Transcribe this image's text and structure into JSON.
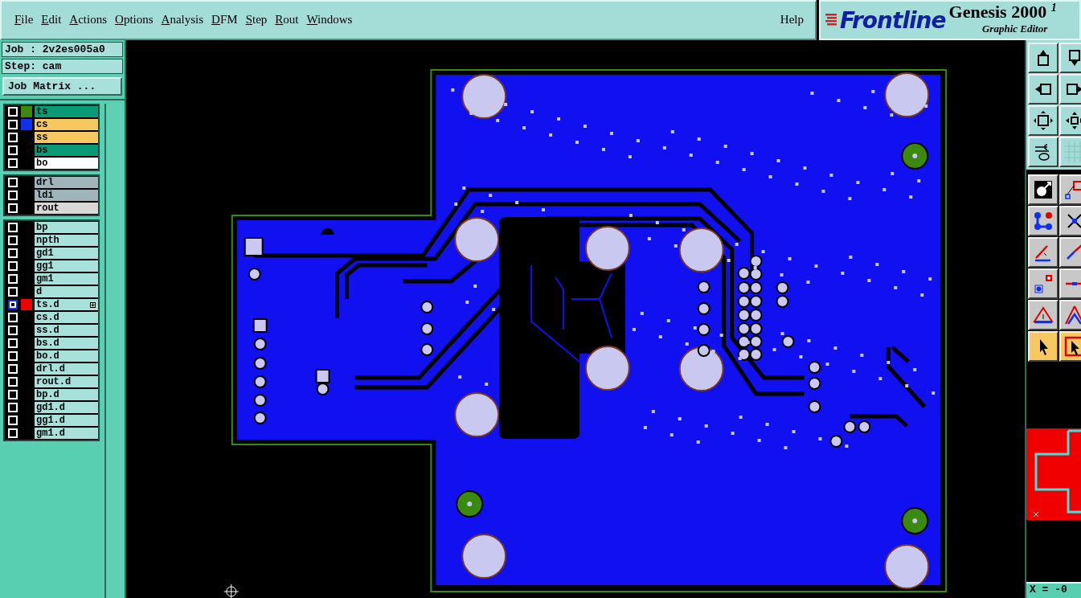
{
  "menu": [
    {
      "label": "File"
    },
    {
      "label": "Edit"
    },
    {
      "label": "Actions"
    },
    {
      "label": "Options"
    },
    {
      "label": "Analysis"
    },
    {
      "label": "DFM"
    },
    {
      "label": "Step"
    },
    {
      "label": "Rout"
    },
    {
      "label": "Windows"
    }
  ],
  "help": "Help",
  "logo": {
    "brand": "Frontline",
    "product": "Genesis 2000",
    "version_mark": "1",
    "subtitle": "Graphic Editor"
  },
  "job": "Job : 2v2es005a0",
  "step": "Step: cam",
  "matrix_button": "Job Matrix ...",
  "layer_groups": [
    [
      {
        "name": "ts",
        "color": "#0a9a78",
        "swatch": {
          "color": "#3a8a10"
        },
        "selected": false
      },
      {
        "name": "cs",
        "color": "#f8c860",
        "swatch": {
          "color": "#1030f0"
        },
        "selected": false
      },
      {
        "name": "ss",
        "color": "#f8c860",
        "selected": false
      },
      {
        "name": "bs",
        "color": "#0a9a78",
        "selected": false
      },
      {
        "name": "bo",
        "color": "#ffffff",
        "selected": false
      }
    ],
    [
      {
        "name": "drl",
        "color": "#a0b4bc",
        "selected": false
      },
      {
        "name": "ldi",
        "color": "#a0b4bc",
        "selected": false
      },
      {
        "name": "rout",
        "color": "#d8d8d8",
        "selected": false
      }
    ],
    [
      {
        "name": "bp",
        "color": "#a8e0dc",
        "selected": false
      },
      {
        "name": "npth",
        "color": "#a8e0dc",
        "selected": false
      },
      {
        "name": "gd1",
        "color": "#a8e0dc",
        "selected": false
      },
      {
        "name": "gg1",
        "color": "#a8e0dc",
        "selected": false
      },
      {
        "name": "gm1",
        "color": "#a8e0dc",
        "selected": false
      },
      {
        "name": "d",
        "color": "#a8e0dc",
        "selected": false
      },
      {
        "name": "ts.d",
        "color": "#a8e0dc",
        "swatch": {
          "color": "#f00000"
        },
        "selected": true
      },
      {
        "name": "cs.d",
        "color": "#a8e0dc",
        "selected": false
      },
      {
        "name": "ss.d",
        "color": "#a8e0dc",
        "selected": false
      },
      {
        "name": "bs.d",
        "color": "#a8e0dc",
        "selected": false
      },
      {
        "name": "bo.d",
        "color": "#a8e0dc",
        "selected": false
      },
      {
        "name": "drl.d",
        "color": "#a8e0dc",
        "selected": false
      },
      {
        "name": "rout.d",
        "color": "#a8e0dc",
        "selected": false
      },
      {
        "name": "bp.d",
        "color": "#a8e0dc",
        "selected": false
      },
      {
        "name": "gd1.d",
        "color": "#a8e0dc",
        "selected": false
      },
      {
        "name": "gg1.d",
        "color": "#a8e0dc",
        "selected": false
      },
      {
        "name": "gm1.d",
        "color": "#a8e0dc",
        "selected": false
      }
    ]
  ],
  "toolbar": {
    "view": [
      {
        "kind": "up",
        "active": false
      },
      {
        "kind": "down",
        "active": false
      },
      {
        "kind": "left",
        "active": false
      },
      {
        "kind": "right",
        "active": false
      },
      {
        "kind": "fit",
        "active": false
      },
      {
        "kind": "center",
        "active": false
      },
      {
        "kind": "tools",
        "active": false
      },
      {
        "kind": "grid",
        "active": false
      }
    ],
    "edit": [
      {
        "kind": "feature",
        "active": false
      },
      {
        "kind": "box",
        "active": false
      },
      {
        "kind": "nodes",
        "active": false
      },
      {
        "kind": "cross",
        "active": false
      },
      {
        "kind": "line",
        "active": false
      },
      {
        "kind": "line2",
        "active": false
      },
      {
        "kind": "pads",
        "active": false
      },
      {
        "kind": "split",
        "active": false
      },
      {
        "kind": "triangle",
        "active": false
      },
      {
        "kind": "triangle2",
        "active": false
      },
      {
        "kind": "pointer",
        "active": true
      },
      {
        "kind": "pointerbox",
        "active": true
      }
    ]
  },
  "coordinates": "X = -0"
}
